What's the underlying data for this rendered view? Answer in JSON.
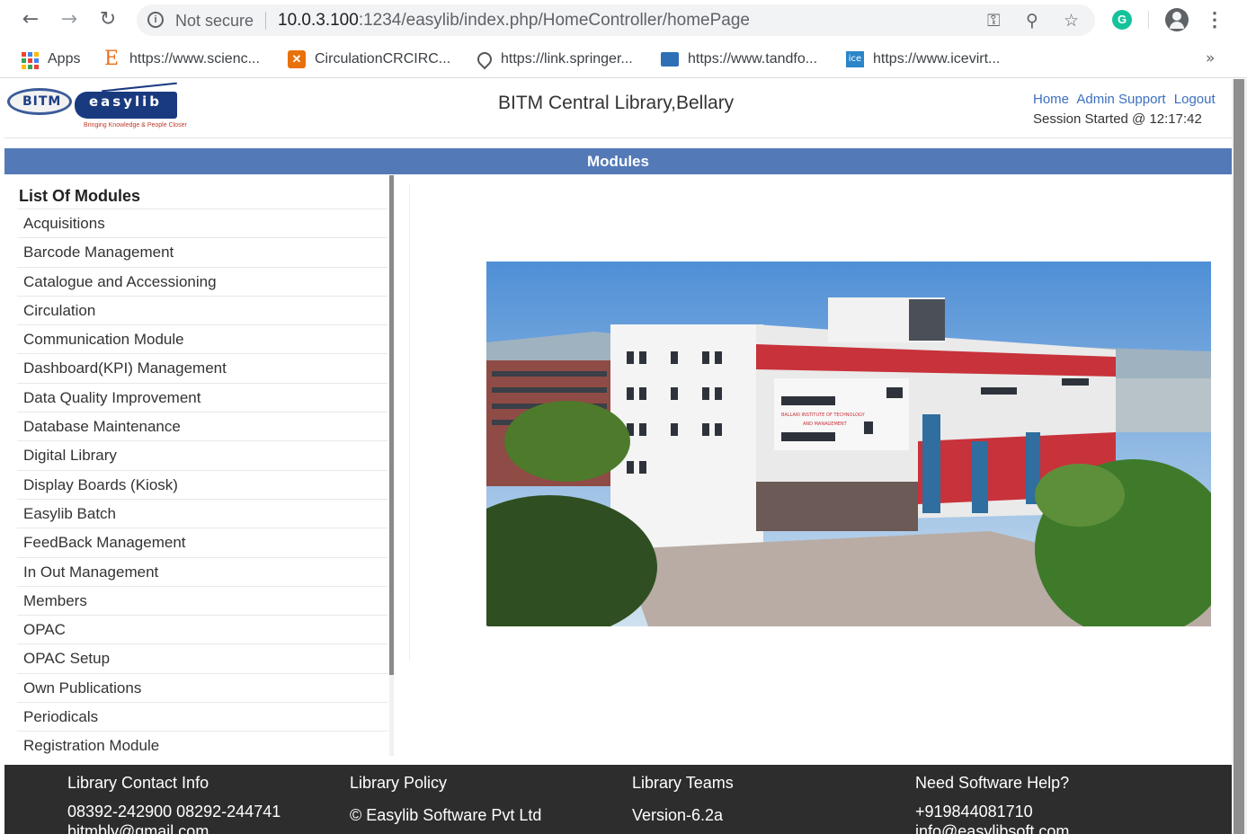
{
  "browser": {
    "security_label": "Not secure",
    "url_host": "10.0.3.100",
    "url_rest": ":1234/easylib/index.php/HomeController/homePage",
    "icons": [
      "back-icon",
      "forward-icon",
      "reload-icon",
      "info-icon",
      "key-icon",
      "zoom-icon",
      "star-icon",
      "grammarly-icon",
      "profile-icon",
      "menu-icon"
    ],
    "bookmarks": [
      {
        "label": "Apps",
        "icon": "apps-grid-icon"
      },
      {
        "label": "https://www.scienc...",
        "icon": "elsevier-icon"
      },
      {
        "label": "CirculationCRCIRC...",
        "icon": "orange-x-icon"
      },
      {
        "label": "https://link.springer...",
        "icon": "springer-icon"
      },
      {
        "label": "https://www.tandfo...",
        "icon": "tandf-icon"
      },
      {
        "label": "https://www.icevirt...",
        "icon": "ice-icon"
      }
    ],
    "more_label": "»"
  },
  "header": {
    "title": "BITM Central Library,Bellary",
    "links": [
      "Home",
      "Admin Support",
      "Logout"
    ],
    "session": "Session Started @ 12:17:42",
    "logo_left_text": "BITM",
    "logo_right_text": "easylib",
    "logo_right_sub": "Bringing Knowledge & People Closer"
  },
  "modules_bar": {
    "title": "Modules"
  },
  "sidebar": {
    "heading": "List Of Modules",
    "items": [
      "Acquisitions",
      "Barcode Management",
      "Catalogue and Accessioning",
      "Circulation",
      "Communication Module",
      "Dashboard(KPI) Management",
      "Data Quality Improvement",
      "Database Maintenance",
      "Digital Library",
      "Display Boards (Kiosk)",
      "Easylib Batch",
      "FeedBack Management",
      "In Out Management",
      "Members",
      "OPAC",
      "OPAC Setup",
      "Own Publications",
      "Periodicals",
      "Registration Module"
    ]
  },
  "photo": {
    "sign_text_1": "BALLARI INSTITUTE OF TECHNOLOGY",
    "sign_text_2": "AND MANAGEMENT"
  },
  "footer": {
    "contact_heading": "Library Contact Info",
    "contact_phone": "08392-242900 08292-244741",
    "contact_email": "bitmbly@gmail.com",
    "policy_heading": "Library Policy",
    "policy_text": "© Easylib Software Pvt Ltd",
    "teams_heading": "Library Teams",
    "teams_text": "Version-6.2a",
    "help_heading": "Need Software Help?",
    "help_phone": "+919844081710",
    "help_email": "info@easylibsoft.com"
  },
  "colors": {
    "modules_bar": "#5379b7",
    "footer": "#2d2d2d",
    "link": "#3c6fbf"
  }
}
